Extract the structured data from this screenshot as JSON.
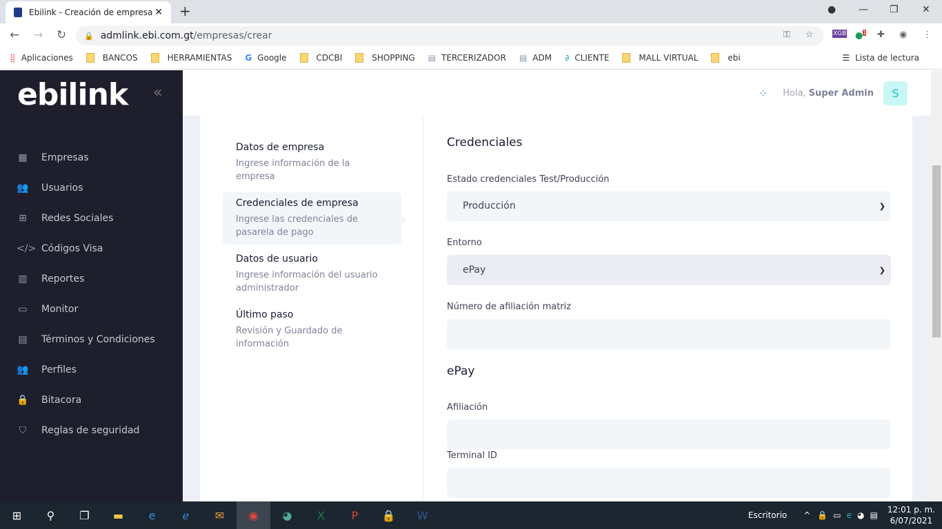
{
  "browser": {
    "tab_title": "Ebilink - Creación de empresa",
    "url_host": "admlink.ebi.com.gt",
    "url_path": "/empresas/crear",
    "bookmarks": [
      "Aplicaciones",
      "BANCOS",
      "HERRAMIENTAS",
      "Google",
      "CDCBI",
      "SHOPPING",
      "TERCERIZADOR",
      "ADM",
      "CLIENTE",
      "MALL VIRTUAL",
      "ebi"
    ],
    "reading_list": "Lista de lectura",
    "ext_badge": "1",
    "ext_xgb": "XGB"
  },
  "sidebar": {
    "logo": "ebilink",
    "items": [
      {
        "icon": "building-icon",
        "glyph": "▦",
        "label": "Empresas"
      },
      {
        "icon": "users-icon",
        "glyph": "👥",
        "label": "Usuarios"
      },
      {
        "icon": "network-icon",
        "glyph": "⊞",
        "label": "Redes Sociales"
      },
      {
        "icon": "code-icon",
        "glyph": "</>",
        "label": "Códigos Visa"
      },
      {
        "icon": "chart-icon",
        "glyph": "▥",
        "label": "Reportes"
      },
      {
        "icon": "monitor-icon",
        "glyph": "▭",
        "label": "Monitor"
      },
      {
        "icon": "document-icon",
        "glyph": "▤",
        "label": "Términos y Condiciones"
      },
      {
        "icon": "profiles-icon",
        "glyph": "👥",
        "label": "Perfiles"
      },
      {
        "icon": "lock-icon",
        "glyph": "🔒",
        "label": "Bitacora"
      },
      {
        "icon": "shield-icon",
        "glyph": "⛉",
        "label": "Reglas de seguridad"
      }
    ]
  },
  "header": {
    "greeting": "Hola,",
    "user": "Super Admin",
    "avatar": "S"
  },
  "steps": [
    {
      "title": "Datos de empresa",
      "desc": "Ingrese información de la empresa"
    },
    {
      "title": "Credenciales de empresa",
      "desc": "Ingrese las credenciales de pasarela de pago"
    },
    {
      "title": "Datos de usuario",
      "desc": "Ingrese información del usuario administrador"
    },
    {
      "title": "Último paso",
      "desc": "Revisión y Guardado de información"
    }
  ],
  "form": {
    "section1": "Credenciales",
    "estado_label": "Estado credenciales Test/Producción",
    "estado_value": "Producción",
    "entorno_label": "Entorno",
    "entorno_value": "ePay",
    "afiliacion_matriz_label": "Número de afiliación matriz",
    "section2": "ePay",
    "afiliacion_label": "Afiliación",
    "terminal_label": "Terminal ID"
  },
  "taskbar": {
    "desktop": "Escritorio",
    "time": "12:01 p. m.",
    "date": "6/07/2021"
  }
}
